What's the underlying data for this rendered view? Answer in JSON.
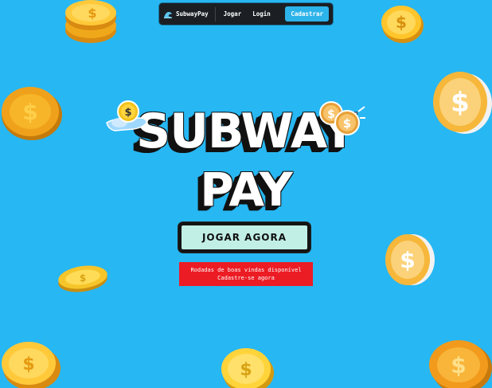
{
  "nav": {
    "brand": "SubwayPay",
    "brand_icon": "wave-icon",
    "links": [
      "Jogar",
      "Login"
    ],
    "cta": "Cadastrar"
  },
  "hero": {
    "title_line1": "SUBWAY",
    "title_line2": "PAY",
    "play_button": "JOGAR AGORA"
  },
  "promo": {
    "line1": "Rodadas de boas vindas disponível",
    "line2": "Cadastre-se agora"
  },
  "colors": {
    "background": "#27b7f3",
    "nav_bg": "#1b1f24",
    "cta": "#2cb3e9",
    "play_button_bg": "#c1efe6",
    "promo_bg": "#ec1c24",
    "coin_gold": "#f4b52a"
  },
  "icons": [
    "wave-icon",
    "dollar-coin-icon",
    "hand-coin-icon"
  ]
}
